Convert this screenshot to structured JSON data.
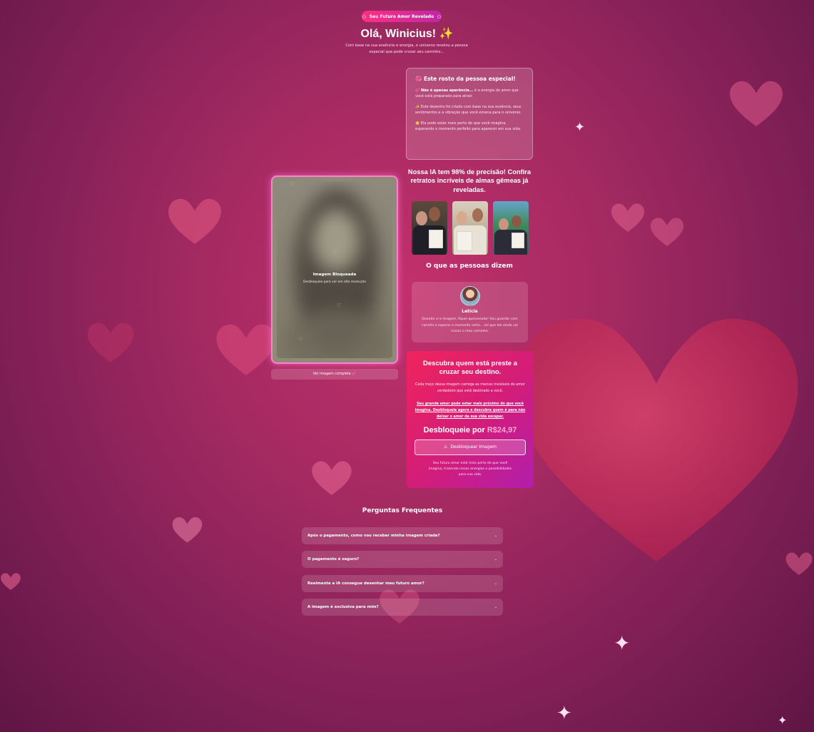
{
  "header": {
    "badge": "Seu Futuro Amor Revelado",
    "title": "Olá, Winicius! ✨",
    "subtitle": "Com base na sua essência e energia, o universo revelou a pessoa especial que pode cruzar seu caminho..."
  },
  "info_card": {
    "title": "💞 Este rosto da pessoa especial!",
    "p1_strong": "💕 Não é apenas aparência...",
    "p1_rest": " é a energia do amor que você está preparado para atrair.",
    "p2": "✨ Este desenho foi criado com base na sua essência, seus sentimentos e a vibração que você emana para o universo.",
    "p3": "🌟 Ela pode estar mais perto do que você imagina, esperando o momento perfeito para aparecer em sua vida."
  },
  "gallery": {
    "heading": "Nossa IA tem 98% de precisão! Confira retratos incríveis de almas gêmeas já reveladas."
  },
  "locked_image": {
    "title": "Imagem Bloqueada",
    "subtitle": "Desbloqueie para ver em alta resolução",
    "see_full": "Ver imagem completa 💕"
  },
  "testimonials": {
    "heading": "O que as pessoas dizem",
    "name": "Letícia",
    "text": "Quando vi a imagem, fiquei apaixonada! Vou guardar com carinho e esperar o momento certo... sei que ele ainda vai cruzar o meu caminho."
  },
  "cta": {
    "title": "Descubra quem está preste a cruzar seu destino.",
    "p1": "Cada traço dessa imagem carrega as marcas invisíveis do amor verdadeiro que está destinado a você.",
    "p2": "Seu grande amor pode estar mais próximo do que você imagina. Desbloqueie agora e descubra quem é para não deixar o amor da sua vida escapar.",
    "price_label": "Desbloqueie por",
    "price_value": "R$24,97",
    "button": "Desbloquear Imagem",
    "footer": "Seu futuro amor está mais perto do que você imagina, trazendo novas energias e possibilidades para sua vida."
  },
  "faq": {
    "title": "Perguntas Frequentes",
    "items": [
      "Após o pagamento, como vou receber minha imagem criada?",
      "O pagamento é seguro?",
      "Realmente a IA consegue desenhar meu futuro amor?",
      "A imagem é exclusiva para mim?"
    ]
  },
  "colors": {
    "accent_pink": "#ff2f83",
    "accent_purple": "#b21eac",
    "price_highlight": "#ffa9d4"
  },
  "icons": [
    "star-icon",
    "lock-icon",
    "heart-icon",
    "warning-icon",
    "chevron-down-icon"
  ]
}
